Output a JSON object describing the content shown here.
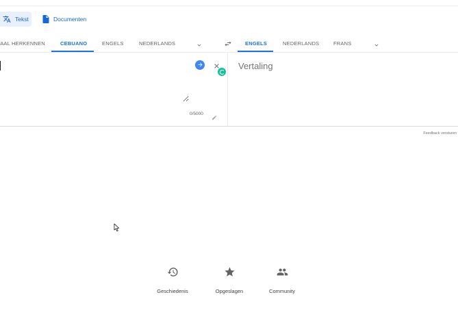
{
  "modes": [
    {
      "label": "Tekst",
      "icon": "translate-icon",
      "active": true
    },
    {
      "label": "Documenten",
      "icon": "document-icon",
      "active": false
    }
  ],
  "source_languages": [
    {
      "label": "TAAL HERKENNEN",
      "active": false
    },
    {
      "label": "CEBUANO",
      "active": true
    },
    {
      "label": "ENGELS",
      "active": false
    },
    {
      "label": "NEDERLANDS",
      "active": false
    }
  ],
  "target_languages": [
    {
      "label": "ENGELS",
      "active": true
    },
    {
      "label": "NEDERLANDS",
      "active": false
    },
    {
      "label": "FRANS",
      "active": false
    }
  ],
  "source": {
    "value": "",
    "char_count": "0/5000"
  },
  "target": {
    "placeholder": "Vertaling"
  },
  "feedback_label": "Feedback versturen",
  "bottom_actions": [
    {
      "label": "Geschiedenis",
      "icon": "history-icon"
    },
    {
      "label": "Opgeslagen",
      "icon": "star-icon"
    },
    {
      "label": "Community",
      "icon": "people-icon"
    }
  ],
  "colors": {
    "accent": "#1a73e8",
    "active_bg": "#e8f0fe",
    "grammarly": "#15c39a"
  }
}
